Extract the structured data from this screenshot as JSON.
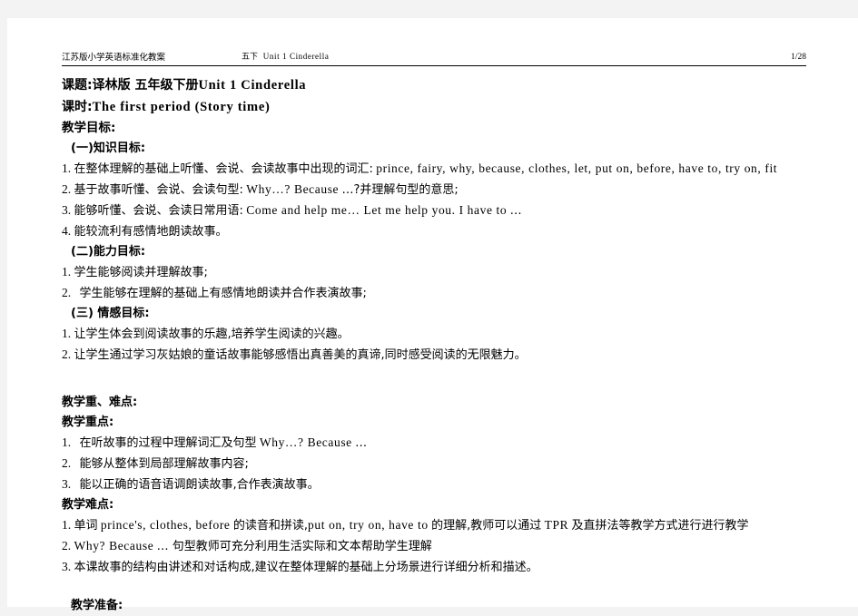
{
  "header": {
    "left": "江苏版小学英语标准化教案",
    "middle_cn": "五下",
    "middle_en": "Unit 1 Cinderella",
    "page_number": "1/28"
  },
  "title": {
    "subject_label": "课题:",
    "subject_cn": "译林版  五年级下册",
    "subject_en": "Unit 1 Cinderella",
    "period_label": "课时:",
    "period_en": "The first period (Story time)"
  },
  "objectives": {
    "heading": "教学目标:",
    "knowledge": {
      "heading": "(一)知识目标:",
      "items": [
        {
          "num": "1.",
          "cn": "在整体理解的基础上听懂、会说、会读故事中出现的词汇:",
          "en": "prince, fairy, why, because, clothes, let, put on, before, have to, try on, fit"
        },
        {
          "num": "2.",
          "cn_pre": "基于故事听懂、会说、会读句型:",
          "en_mid": "Why…? Because",
          "cn_post": "…?并理解句型的意思;"
        },
        {
          "num": "3.",
          "cn_pre": "能够听懂、会说、会读日常用语:",
          "en_mid": "Come and help me… Let me help you. I have to",
          "cn_post": "…"
        },
        {
          "num": "4.",
          "cn": "能较流利有感情地朗读故事。"
        }
      ]
    },
    "ability": {
      "heading": "(二)能力目标:",
      "items": [
        {
          "num": "1.",
          "cn": "学生能够阅读并理解故事;"
        },
        {
          "num": "2.",
          "cn": "学生能够在理解的基础上有感情地朗读并合作表演故事;"
        }
      ]
    },
    "emotion": {
      "heading": "(三) 情感目标:",
      "items": [
        {
          "num": "1.",
          "cn": "让学生体会到阅读故事的乐趣,培养学生阅读的兴趣。"
        },
        {
          "num": "2.",
          "cn": "让学生通过学习灰姑娘的童话故事能够感悟出真善美的真谛,同时感受阅读的无限魅力。"
        }
      ]
    }
  },
  "key_difficult": {
    "heading": "教学重、难点:",
    "key": {
      "heading": "教学重点:",
      "items": [
        {
          "num": "1.",
          "cn_pre": "在听故事的过程中理解词汇及句型",
          "en_mid": "Why…? Because",
          "cn_post": "…"
        },
        {
          "num": "2.",
          "cn": "能够从整体到局部理解故事内容;"
        },
        {
          "num": "3.",
          "cn": "能以正确的语音语调朗读故事,合作表演故事。"
        }
      ]
    },
    "difficult": {
      "heading": "教学难点:",
      "items": [
        {
          "num": "1.",
          "cn_a": "单词",
          "en_a": "prince's, clothes, before",
          "cn_b": "的读音和拼读,",
          "en_b": "put on, try on, have to",
          "cn_c": "的理解,教师可以通过",
          "en_c": "TPR",
          "cn_d": "及直拼法等教学方式进行进行教学"
        },
        {
          "num": "2.",
          "en_a": "Why? Because",
          "cn_a": "…  句型教师可充分利用生活实际和文本帮助学生理解"
        },
        {
          "num": "3.",
          "cn_a": "本课故事的结构由讲述和对话构成,建议在整体理解的基础上分场景进行详细分析和描述。"
        }
      ]
    }
  },
  "preparation": {
    "heading": "教学准备:"
  }
}
